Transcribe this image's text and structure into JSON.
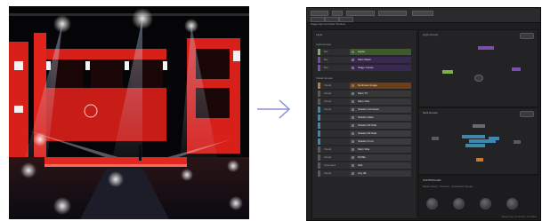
{
  "app": {
    "window_title": "Stagemap Controller Window",
    "layer_panel_label": "Layer",
    "graph_top_label": "Light Groups",
    "graph_bottom_label": "Multi Render",
    "controller_title": "CONTROLLER",
    "controller_subtitle": "Mode Select · Kinetics · Quantized Sweep",
    "status_text": "Stagemap Controller 2.0 Beta"
  },
  "groups": [
    {
      "name": "Light Groups",
      "rows": [
        {
          "name": "Bar",
          "label": "Lights",
          "color": "#7fb24a",
          "bar": "#3e5a28"
        },
        {
          "name": "Bar",
          "label": "Main Wash",
          "color": "#6b4fa0",
          "bar": "#37294f"
        },
        {
          "name": "Bar",
          "label": "Stage Center",
          "color": "#7a4fa8",
          "bar": "#3a2852"
        }
      ]
    },
    {
      "name": "Visual Groups",
      "rows": [
        {
          "name": "Visual",
          "label": "Nonlinear Image",
          "color": "#c77a2a",
          "bar": "#6b4016"
        },
        {
          "name": "Visual",
          "label": "Main TV",
          "color": "#5a5a5a",
          "bar": "#37373a"
        },
        {
          "name": "Visual",
          "label": "Main Vibe",
          "color": "#5a5a5a",
          "bar": "#37373a"
        },
        {
          "name": "Visual",
          "label": "Shader Overhead",
          "color": "#3e88b0",
          "bar": "#3b3b3f"
        },
        {
          "name": "",
          "label": "Shader Glare",
          "color": "#3e88b0",
          "bar": "#3b3b3f"
        },
        {
          "name": "",
          "label": "Shader Fill Side",
          "color": "#3e88b0",
          "bar": "#3b3b3f"
        },
        {
          "name": "",
          "label": "Shader Fill Side",
          "color": "#3e88b0",
          "bar": "#3b3b3f"
        },
        {
          "name": "",
          "label": "Shader Front",
          "color": "#3e88b0",
          "bar": "#3b3b3f"
        },
        {
          "name": "Visual",
          "label": "Main Vibe",
          "color": "#5a5a5a",
          "bar": "#37373a"
        },
        {
          "name": "Visual",
          "label": "NOSE",
          "color": "#5a5a5a",
          "bar": "#37373a"
        },
        {
          "name": "Keyboard",
          "label": "Sub",
          "color": "#5a5a5a",
          "bar": "#37373a"
        },
        {
          "name": "Visual",
          "label": "Any 28",
          "color": "#5a5a5a",
          "bar": "#37373a"
        }
      ]
    }
  ],
  "colors": {
    "accent_green": "#7fb24a",
    "accent_purple": "#7a4fa8",
    "accent_orange": "#c77a2a",
    "accent_blue": "#3e88b0",
    "stage_red": "#d8201a",
    "arrow": "#8a8fd8"
  },
  "icons": {
    "arrow": "arrow-right-icon"
  }
}
